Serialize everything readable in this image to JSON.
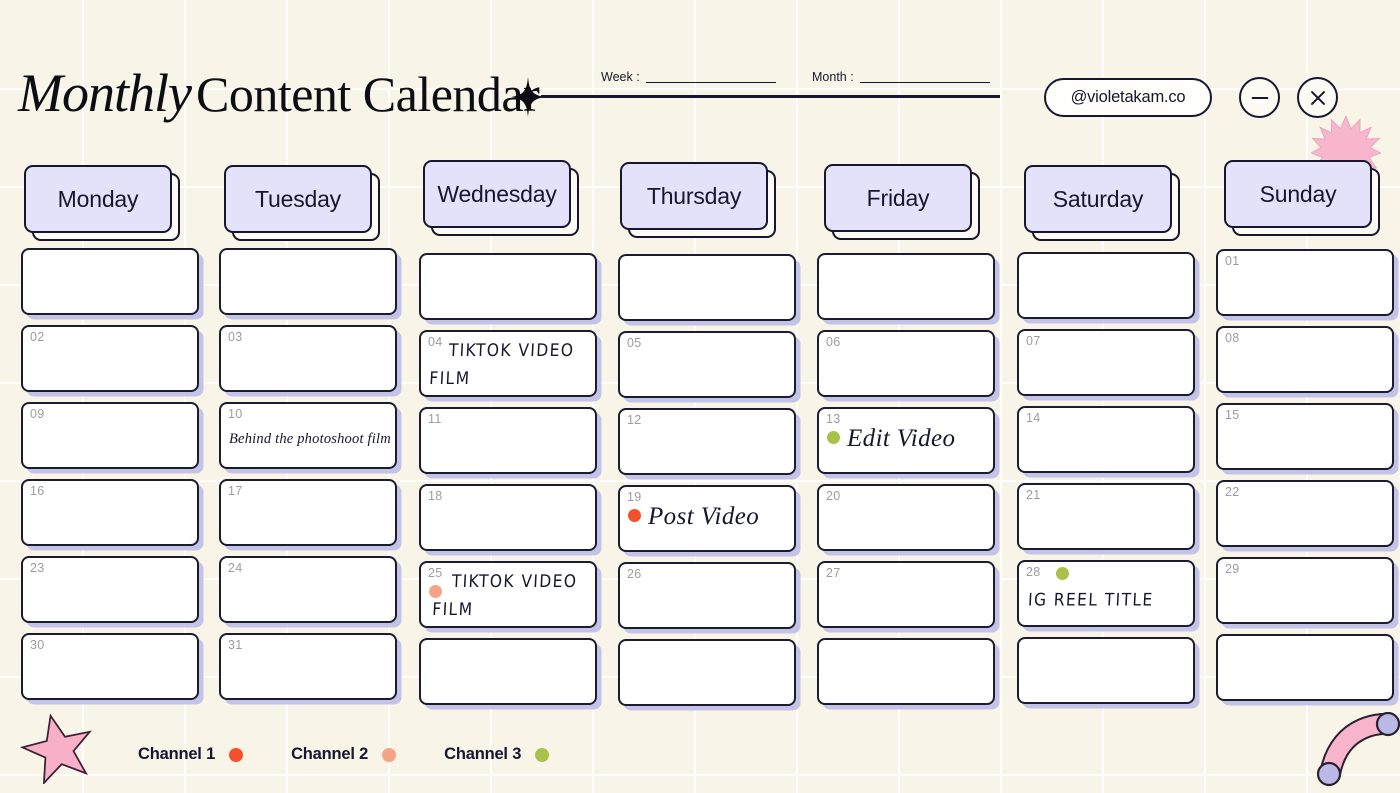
{
  "header": {
    "title_italic": "Monthly",
    "title_regular": "Content Calendar",
    "sparkle_icon": "four-point-sparkle-icon",
    "week_label": "Week :",
    "week_value": "",
    "month_label": "Month :",
    "month_value": "",
    "handle": "@violetakam.co",
    "minimize_glyph": "—",
    "close_glyph": "✕"
  },
  "colors": {
    "background": "#f8f4e8",
    "ink": "#16162e",
    "header_chip": "#e3e2fa",
    "cell_shadow": "#c3c3e8",
    "channel_1": "#f4512c",
    "channel_2": "#f6a485",
    "channel_3": "#a8c249",
    "pink_decor": "#f9b9cc"
  },
  "decorations": [
    {
      "name": "pink-starburst-decor",
      "shape": "starburst"
    },
    {
      "name": "pink-star-decor",
      "shape": "five-point-star"
    },
    {
      "name": "pink-arc-decor",
      "shape": "curved-arc"
    }
  ],
  "weekdays": [
    "Monday",
    "Tuesday",
    "Wednesday",
    "Thursday",
    "Friday",
    "Saturday",
    "Sunday"
  ],
  "columns": [
    {
      "day": "Monday",
      "cells": [
        {
          "num": "",
          "text": "",
          "dot": "",
          "style": ""
        },
        {
          "num": "02",
          "text": "",
          "dot": "",
          "style": ""
        },
        {
          "num": "09",
          "text": "",
          "dot": "",
          "style": ""
        },
        {
          "num": "16",
          "text": "",
          "dot": "",
          "style": ""
        },
        {
          "num": "23",
          "text": "",
          "dot": "",
          "style": ""
        },
        {
          "num": "30",
          "text": "",
          "dot": "",
          "style": ""
        }
      ]
    },
    {
      "day": "Tuesday",
      "cells": [
        {
          "num": "",
          "text": "",
          "dot": "",
          "style": ""
        },
        {
          "num": "03",
          "text": "",
          "dot": "",
          "style": ""
        },
        {
          "num": "10",
          "text": "Behind the photoshoot film",
          "dot": "",
          "style": "script-small"
        },
        {
          "num": "17",
          "text": "",
          "dot": "",
          "style": ""
        },
        {
          "num": "24",
          "text": "",
          "dot": "",
          "style": ""
        },
        {
          "num": "31",
          "text": "",
          "dot": "",
          "style": ""
        }
      ]
    },
    {
      "day": "Wednesday",
      "cells": [
        {
          "num": "",
          "text": "",
          "dot": "",
          "style": ""
        },
        {
          "num": "04",
          "text": "TIKTOK VIDEO\nFILM",
          "dot": "",
          "style": "print"
        },
        {
          "num": "11",
          "text": "",
          "dot": "",
          "style": ""
        },
        {
          "num": "18",
          "text": "",
          "dot": "",
          "style": ""
        },
        {
          "num": "25",
          "text": "TIKTOK VIDEO\nFILM",
          "dot": "channel_2",
          "style": "print"
        },
        {
          "num": "",
          "text": "",
          "dot": "",
          "style": ""
        }
      ]
    },
    {
      "day": "Thursday",
      "cells": [
        {
          "num": "",
          "text": "",
          "dot": "",
          "style": ""
        },
        {
          "num": "05",
          "text": "",
          "dot": "",
          "style": ""
        },
        {
          "num": "12",
          "text": "",
          "dot": "",
          "style": ""
        },
        {
          "num": "19",
          "text": "Post Video",
          "dot": "channel_1",
          "style": "script"
        },
        {
          "num": "26",
          "text": "",
          "dot": "",
          "style": ""
        },
        {
          "num": "",
          "text": "",
          "dot": "",
          "style": ""
        }
      ]
    },
    {
      "day": "Friday",
      "cells": [
        {
          "num": "",
          "text": "",
          "dot": "",
          "style": ""
        },
        {
          "num": "06",
          "text": "",
          "dot": "",
          "style": ""
        },
        {
          "num": "13",
          "text": "Edit Video",
          "dot": "channel_3",
          "style": "script"
        },
        {
          "num": "20",
          "text": "",
          "dot": "",
          "style": ""
        },
        {
          "num": "27",
          "text": "",
          "dot": "",
          "style": ""
        },
        {
          "num": "",
          "text": "",
          "dot": "",
          "style": ""
        }
      ]
    },
    {
      "day": "Saturday",
      "cells": [
        {
          "num": "",
          "text": "",
          "dot": "",
          "style": ""
        },
        {
          "num": "07",
          "text": "",
          "dot": "",
          "style": ""
        },
        {
          "num": "14",
          "text": "",
          "dot": "",
          "style": ""
        },
        {
          "num": "21",
          "text": "",
          "dot": "",
          "style": ""
        },
        {
          "num": "28",
          "text": "IG REEL TITLE",
          "dot": "channel_3_top",
          "style": "print"
        },
        {
          "num": "",
          "text": "",
          "dot": "",
          "style": ""
        }
      ]
    },
    {
      "day": "Sunday",
      "cells": [
        {
          "num": "01",
          "text": "",
          "dot": "",
          "style": ""
        },
        {
          "num": "08",
          "text": "",
          "dot": "",
          "style": ""
        },
        {
          "num": "15",
          "text": "",
          "dot": "",
          "style": ""
        },
        {
          "num": "22",
          "text": "",
          "dot": "",
          "style": ""
        },
        {
          "num": "29",
          "text": "",
          "dot": "",
          "style": ""
        },
        {
          "num": "",
          "text": "",
          "dot": "",
          "style": ""
        }
      ]
    }
  ],
  "legend": [
    {
      "label": "Channel 1",
      "color": "#f4512c"
    },
    {
      "label": "Channel 2",
      "color": "#f6a485"
    },
    {
      "label": "Channel 3",
      "color": "#a8c249"
    }
  ]
}
